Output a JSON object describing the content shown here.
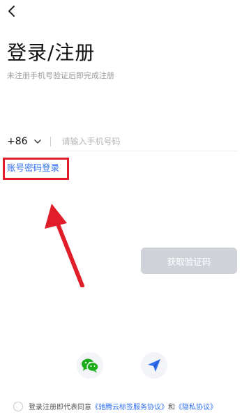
{
  "header": {
    "title": "登录/注册",
    "subtitle": "未注册手机号验证后即完成注册"
  },
  "phone": {
    "country_code": "+86",
    "placeholder": "请输入手机号码"
  },
  "password_login_link": "账号密码登录",
  "get_code_button": "获取验证码",
  "agreement": {
    "prefix": "登录注册即代表同意",
    "service_link": "《驰腾云标签服务协议》",
    "and": "和",
    "privacy_link": "《隐私协议》"
  },
  "colors": {
    "accent": "#2f6ff0",
    "highlight": "#e11d2a",
    "wechat": "#1aad19"
  },
  "icons": [
    "back-icon",
    "chevron-down-icon",
    "wechat-icon",
    "send-icon"
  ]
}
